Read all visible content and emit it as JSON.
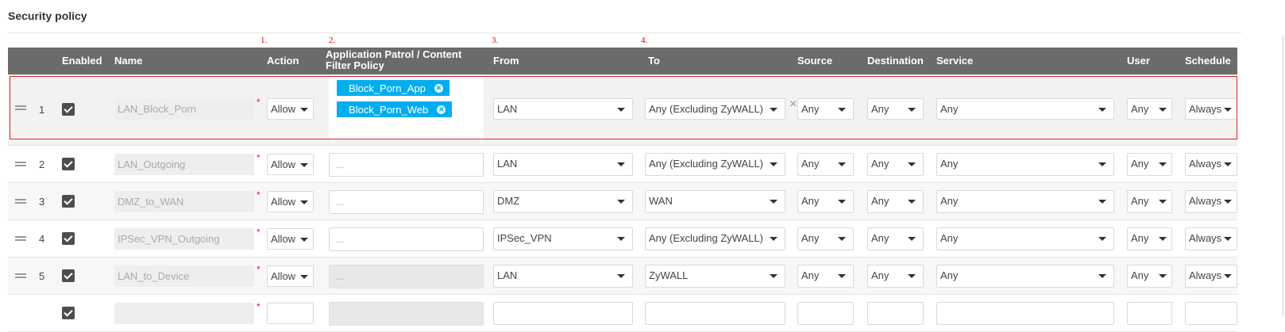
{
  "page_title": "Security policy",
  "annotations": [
    "1.",
    "2.",
    "3.",
    "4."
  ],
  "columns": {
    "enabled": "Enabled",
    "name": "Name",
    "action": "Action",
    "policy": "Application Patrol / Content Filter Policy",
    "from": "From",
    "to": "To",
    "source": "Source",
    "destination": "Destination",
    "service": "Service",
    "user": "User",
    "schedule": "Schedule"
  },
  "required_mark": "*",
  "policy_placeholder": "...",
  "clear_symbol": "×",
  "rows": [
    {
      "num": "1",
      "name": "LAN_Block_Porn",
      "action": "Allow",
      "tags": [
        "Block_Porn_App",
        "Block_Porn_Web"
      ],
      "from": "LAN",
      "to": "Any (Excluding ZyWALL)",
      "source": "Any",
      "destination": "Any",
      "service": "Any",
      "user": "Any",
      "schedule": "Always"
    },
    {
      "num": "2",
      "name": "LAN_Outgoing",
      "action": "Allow",
      "from": "LAN",
      "to": "Any (Excluding ZyWALL)",
      "source": "Any",
      "destination": "Any",
      "service": "Any",
      "user": "Any",
      "schedule": "Always"
    },
    {
      "num": "3",
      "name": "DMZ_to_WAN",
      "action": "Allow",
      "from": "DMZ",
      "to": "WAN",
      "source": "Any",
      "destination": "Any",
      "service": "Any",
      "user": "Any",
      "schedule": "Always"
    },
    {
      "num": "4",
      "name": "IPSec_VPN_Outgoing",
      "action": "Allow",
      "from": "IPSec_VPN",
      "to": "Any (Excluding ZyWALL)",
      "source": "Any",
      "destination": "Any",
      "service": "Any",
      "user": "Any",
      "schedule": "Always"
    },
    {
      "num": "5",
      "name": "LAN_to_Device",
      "action": "Allow",
      "from": "LAN",
      "to": "ZyWALL",
      "source": "Any",
      "destination": "Any",
      "service": "Any",
      "user": "Any",
      "schedule": "Always"
    }
  ],
  "icons": {
    "drag_handle": "drag-handle-icon",
    "checkbox": "checkbox-checked-icon",
    "caret": "caret-down-icon",
    "tag_remove": "tag-remove-icon",
    "clear": "clear-icon"
  },
  "colors": {
    "header_bg": "#6b6b6b",
    "tag_bg": "#00aeef",
    "highlight_border": "#e0202a",
    "annotation": "#dd0000",
    "checkbox": "#4d4d4d"
  }
}
